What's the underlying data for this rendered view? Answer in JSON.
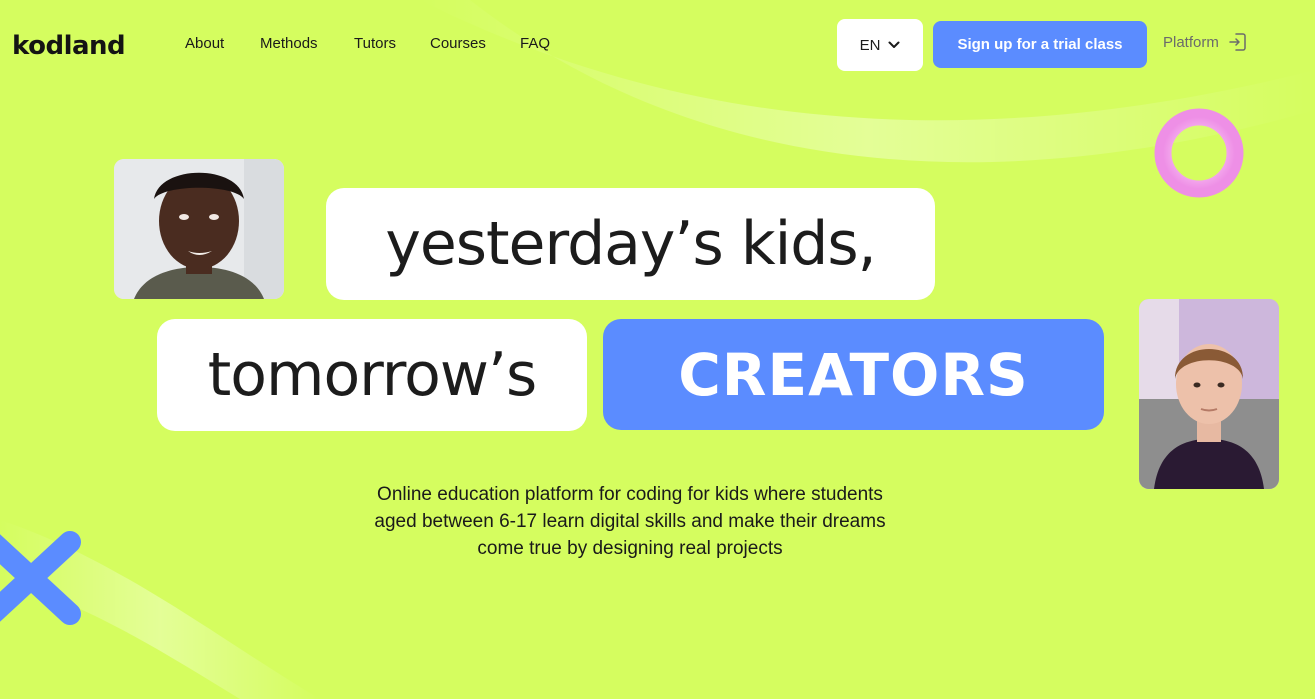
{
  "header": {
    "logo_text": "kodland",
    "nav": [
      {
        "label": "About"
      },
      {
        "label": "Methods"
      },
      {
        "label": "Tutors"
      },
      {
        "label": "Courses"
      },
      {
        "label": "FAQ"
      }
    ],
    "language": "EN",
    "signup_label": "Sign up for a trial class",
    "platform_label": "Platform"
  },
  "hero": {
    "line1": "yesterday’s kids,",
    "line2_a": "tomorrow’s",
    "line2_b": "CREATORS",
    "description": "Online education platform for coding for kids where students aged between 6-17 learn digital skills and make their dreams come true by designing real projects"
  },
  "colors": {
    "background": "#d5fd5f",
    "accent_blue": "#5b8cff",
    "ring_pink": "#f5a3f0",
    "pill_white": "#ffffff"
  },
  "icons": [
    "chevron-down-icon",
    "login-arrow-icon",
    "ring-decoration",
    "x-decoration"
  ]
}
